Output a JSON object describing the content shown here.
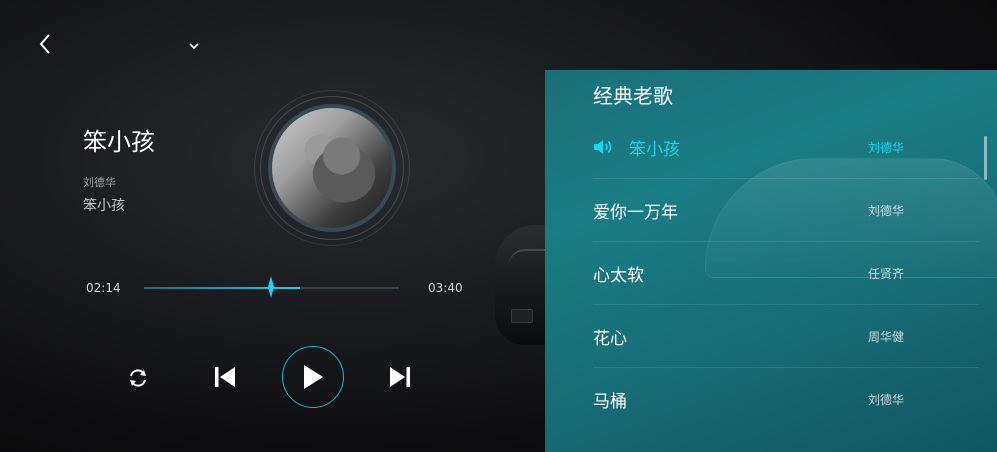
{
  "now_playing": {
    "title": "笨小孩",
    "artist": "刘德华",
    "album": "笨小孩",
    "current_time": "02:14",
    "total_time": "03:40",
    "progress": 0.61
  },
  "controls": {
    "repeat_icon": "repeat-icon",
    "prev_icon": "skip-previous-icon",
    "play_icon": "play-icon",
    "next_icon": "skip-next-icon"
  },
  "playlist": {
    "title": "经典老歌",
    "tracks": [
      {
        "name": "笨小孩",
        "artist": "刘德华",
        "active": true
      },
      {
        "name": "爱你一万年",
        "artist": "刘德华",
        "active": false
      },
      {
        "name": "心太软",
        "artist": "任贤齐",
        "active": false
      },
      {
        "name": "花心",
        "artist": "周华健",
        "active": false
      },
      {
        "name": "马桶",
        "artist": "刘德华",
        "active": false
      }
    ]
  },
  "colors": {
    "accent": "#19d3f0",
    "panel": "#1a7c84"
  }
}
